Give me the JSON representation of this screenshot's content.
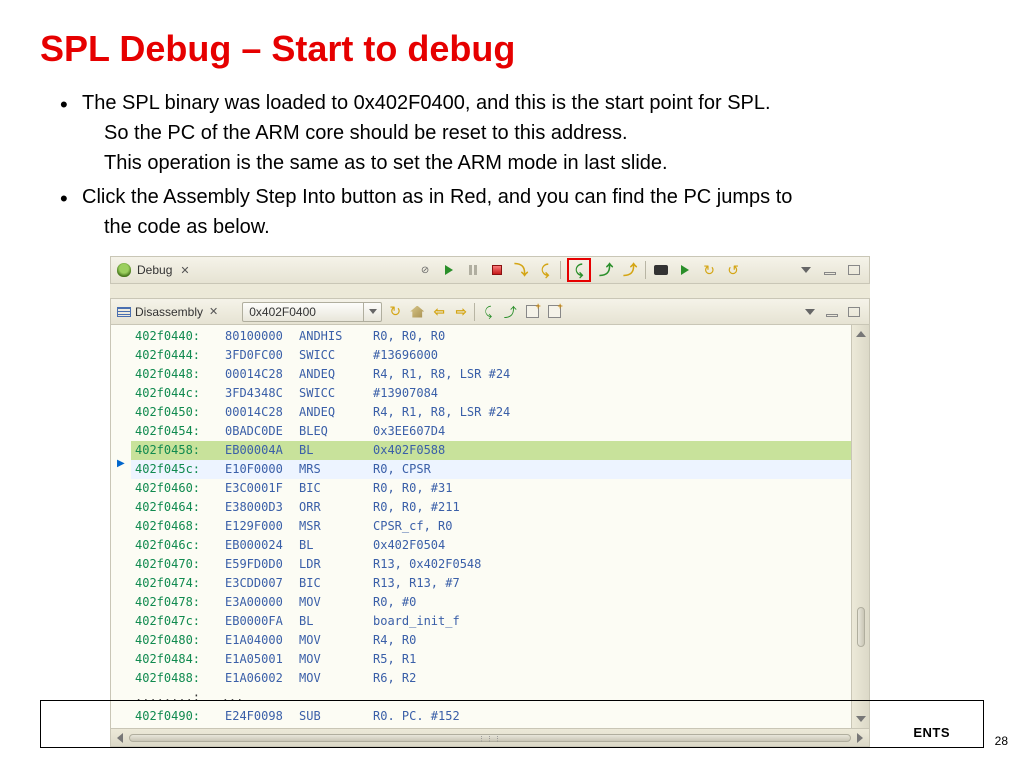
{
  "slide": {
    "title": "SPL Debug – Start to debug",
    "page_number": "28",
    "brand_fragment": "ENTS",
    "bullets": [
      {
        "lines": [
          "The SPL binary was loaded to 0x402F0400, and this is the start point for SPL.",
          "So the PC of the ARM core should be reset to this address.",
          "This operation is the same as to set the ARM mode in last slide."
        ]
      },
      {
        "lines": [
          "Click the Assembly Step Into button as in Red, and you can find the PC jumps to",
          "the code as below."
        ]
      }
    ]
  },
  "debug_tab": {
    "label": "Debug",
    "close": "✕"
  },
  "disasm_tab": {
    "label": "Disassembly",
    "close": "✕",
    "address": "0x402F0400"
  },
  "code": [
    {
      "addr": "402f0440:",
      "opc": "80100000",
      "mn": "ANDHIS",
      "ops": "R0, R0, R0",
      "cur": false
    },
    {
      "addr": "402f0444:",
      "opc": "3FD0FC00",
      "mn": "SWICC",
      "ops": "#13696000",
      "cur": false
    },
    {
      "addr": "402f0448:",
      "opc": "00014C28",
      "mn": "ANDEQ",
      "ops": "R4, R1, R8, LSR #24",
      "cur": false
    },
    {
      "addr": "402f044c:",
      "opc": "3FD4348C",
      "mn": "SWICC",
      "ops": "#13907084",
      "cur": false
    },
    {
      "addr": "402f0450:",
      "opc": "00014C28",
      "mn": "ANDEQ",
      "ops": "R4, R1, R8, LSR #24",
      "cur": false
    },
    {
      "addr": "402f0454:",
      "opc": "0BADC0DE",
      "mn": "BLEQ",
      "ops": "0x3EE607D4",
      "cur": false
    },
    {
      "addr": "402f0458:",
      "opc": "EB00004A",
      "mn": "BL",
      "ops": "0x402F0588",
      "cur": true
    },
    {
      "addr": "402f045c:",
      "opc": "E10F0000",
      "mn": "MRS",
      "ops": "R0, CPSR",
      "cur": false
    },
    {
      "addr": "402f0460:",
      "opc": "E3C0001F",
      "mn": "BIC",
      "ops": "R0, R0, #31",
      "cur": false
    },
    {
      "addr": "402f0464:",
      "opc": "E38000D3",
      "mn": "ORR",
      "ops": "R0, R0, #211",
      "cur": false
    },
    {
      "addr": "402f0468:",
      "opc": "E129F000",
      "mn": "MSR",
      "ops": "CPSR_cf, R0",
      "cur": false
    },
    {
      "addr": "402f046c:",
      "opc": "EB000024",
      "mn": "BL",
      "ops": "0x402F0504",
      "cur": false
    },
    {
      "addr": "402f0470:",
      "opc": "E59FD0D0",
      "mn": "LDR",
      "ops": "R13, 0x402F0548",
      "cur": false
    },
    {
      "addr": "402f0474:",
      "opc": "E3CDD007",
      "mn": "BIC",
      "ops": "R13, R13, #7",
      "cur": false
    },
    {
      "addr": "402f0478:",
      "opc": "E3A00000",
      "mn": "MOV",
      "ops": "R0, #0",
      "cur": false
    },
    {
      "addr": "402f047c:",
      "opc": "EB0000FA",
      "mn": "BL",
      "ops": "board_init_f",
      "cur": false
    },
    {
      "addr": "402f0480:",
      "opc": "E1A04000",
      "mn": "MOV",
      "ops": "R4, R0",
      "cur": false
    },
    {
      "addr": "402f0484:",
      "opc": "E1A05001",
      "mn": "MOV",
      "ops": "R5, R1",
      "cur": false
    },
    {
      "addr": "402f0488:",
      "opc": "E1A06002",
      "mn": "MOV",
      "ops": "R6, R2",
      "cur": false
    }
  ],
  "code_trailing": {
    "dots": "........:   ...",
    "addr": "402f0490:",
    "opc": "E24F0098",
    "mn": "SUB",
    "ops": "R0. PC. #152"
  }
}
